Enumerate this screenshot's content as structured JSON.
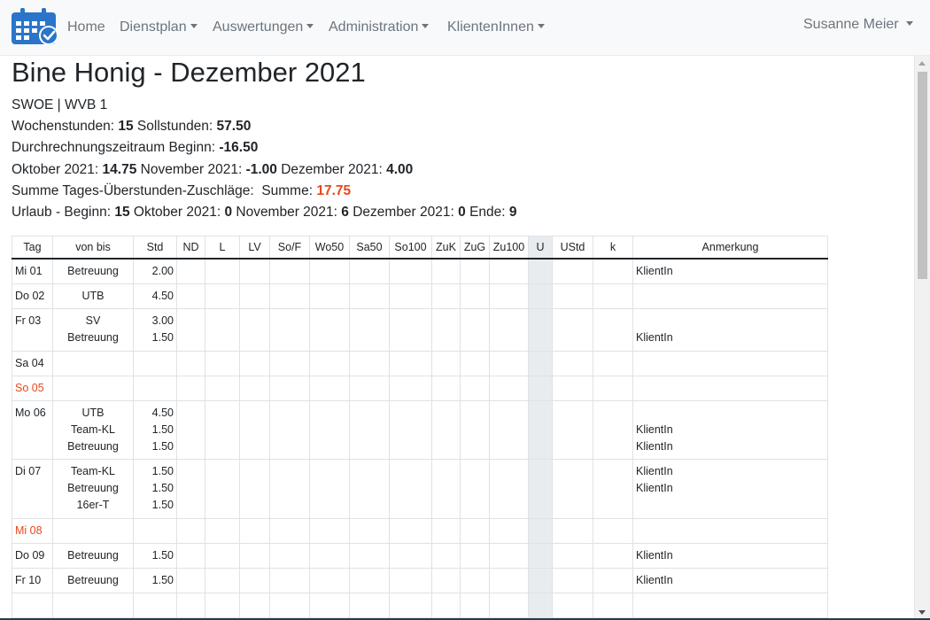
{
  "nav": {
    "items": [
      {
        "label": "Home"
      },
      {
        "label": "Dienstplan"
      },
      {
        "label": "Auswertungen"
      },
      {
        "label": "Administration"
      },
      {
        "label": "KlientenInnen"
      }
    ],
    "user": "Susanne Meier",
    "logo_icon": "calendar-check-icon",
    "brand_color": "#2a75c9"
  },
  "page": {
    "title": "Bine Honig - Dezember 2021",
    "unit": "SWOE | WVB 1",
    "wochenstunden_label": "Wochenstunden:",
    "wochenstunden": "15",
    "sollstunden_label": "Sollstunden:",
    "sollstunden": "57.50",
    "dzr_label": "Durchrechnungszeitraum Beginn:",
    "dzr": "-16.50",
    "okt_label": "Oktober 2021:",
    "okt": "14.75",
    "nov_label": "November 2021:",
    "nov": "-1.00",
    "dez_label": "Dezember 2021:",
    "dez": "4.00",
    "zuschlaege_label": "Summe Tages-Überstunden-Zuschläge:",
    "summe_label": "Summe:",
    "summe": "17.75",
    "urlaub_label": "Urlaub - Beginn:",
    "urlaub_beginn": "15",
    "urlaub_okt_label": "Oktober 2021:",
    "urlaub_okt": "0",
    "urlaub_nov_label": "November 2021:",
    "urlaub_nov": "6",
    "urlaub_dez_label": "Dezember 2021:",
    "urlaub_dez": "0",
    "urlaub_ende_label": "Ende:",
    "urlaub_ende": "9",
    "accent_color": "#e8471c"
  },
  "table": {
    "headers": [
      "Tag",
      "von bis",
      "Std",
      "ND",
      "L",
      "LV",
      "So/F",
      "Wo50",
      "Sa50",
      "So100",
      "ZuK",
      "ZuG",
      "Zu100",
      "U",
      "UStd",
      "k",
      "Anmerkung"
    ],
    "rows": [
      {
        "tag": "Mi 01",
        "sunday": false,
        "entries": [
          {
            "vb": "Betreuung",
            "std": "2.00",
            "anm": "KlientIn"
          }
        ]
      },
      {
        "tag": "Do 02",
        "sunday": false,
        "entries": [
          {
            "vb": "UTB",
            "std": "4.50",
            "anm": ""
          }
        ]
      },
      {
        "tag": "Fr 03",
        "sunday": false,
        "entries": [
          {
            "vb": "SV",
            "std": "3.00",
            "anm": ""
          },
          {
            "vb": "Betreuung",
            "std": "1.50",
            "anm": "KlientIn"
          }
        ]
      },
      {
        "tag": "Sa 04",
        "sunday": false,
        "entries": []
      },
      {
        "tag": "So 05",
        "sunday": true,
        "entries": []
      },
      {
        "tag": "Mo 06",
        "sunday": false,
        "entries": [
          {
            "vb": "UTB",
            "std": "4.50",
            "anm": ""
          },
          {
            "vb": "Team-KL",
            "std": "1.50",
            "anm": "KlientIn"
          },
          {
            "vb": "Betreuung",
            "std": "1.50",
            "anm": "KlientIn"
          }
        ]
      },
      {
        "tag": "Di 07",
        "sunday": false,
        "entries": [
          {
            "vb": "Team-KL",
            "std": "1.50",
            "anm": "KlientIn"
          },
          {
            "vb": "Betreuung",
            "std": "1.50",
            "anm": "KlientIn"
          },
          {
            "vb": "16er-T",
            "std": "1.50",
            "anm": ""
          }
        ]
      },
      {
        "tag": "Mi 08",
        "sunday": true,
        "entries": []
      },
      {
        "tag": "Do 09",
        "sunday": false,
        "entries": [
          {
            "vb": "Betreuung",
            "std": "1.50",
            "anm": "KlientIn"
          }
        ]
      },
      {
        "tag": "Fr 10",
        "sunday": false,
        "entries": [
          {
            "vb": "Betreuung",
            "std": "1.50",
            "anm": "KlientIn"
          }
        ]
      },
      {
        "tag": "",
        "sunday": false,
        "entries": []
      }
    ]
  }
}
